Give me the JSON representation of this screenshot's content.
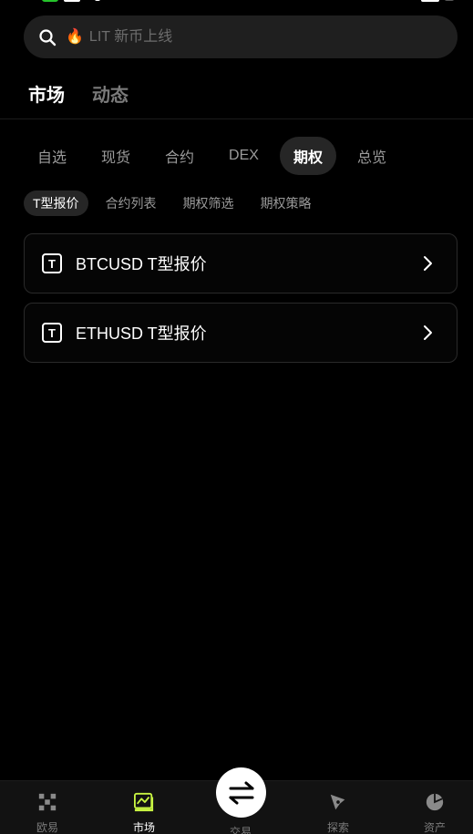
{
  "search": {
    "placeholder": "LIT 新币上线",
    "fire_icon": "🔥"
  },
  "main_tabs": [
    {
      "label": "市场",
      "active": true
    },
    {
      "label": "动态",
      "active": false
    }
  ],
  "sub_tabs": [
    {
      "label": "自选"
    },
    {
      "label": "现货"
    },
    {
      "label": "合约"
    },
    {
      "label": "DEX"
    },
    {
      "label": "期权",
      "active": true
    },
    {
      "label": "总览"
    }
  ],
  "chips": [
    {
      "label": "T型报价",
      "active": true
    },
    {
      "label": "合约列表"
    },
    {
      "label": "期权筛选"
    },
    {
      "label": "期权策略"
    }
  ],
  "cards": [
    {
      "icon_letter": "T",
      "label": "BTCUSD T型报价"
    },
    {
      "icon_letter": "T",
      "label": "ETHUSD T型报价"
    }
  ],
  "bottom_nav": [
    {
      "label": "欧易",
      "icon": "okx-logo-icon"
    },
    {
      "label": "市场",
      "icon": "market-chart-icon",
      "active": true
    },
    {
      "label": "交易",
      "icon": "swap-arrows-icon"
    },
    {
      "label": "探索",
      "icon": "compass-icon"
    },
    {
      "label": "资产",
      "icon": "pie-chart-icon"
    }
  ],
  "colors": {
    "accent": "#c8f542",
    "background": "#000000",
    "surface": "#262626"
  }
}
